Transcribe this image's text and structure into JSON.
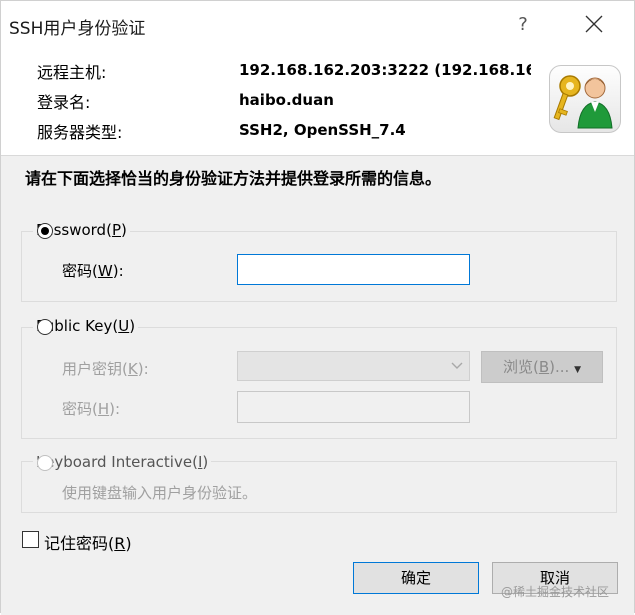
{
  "window": {
    "title": "SSH用户身份验证",
    "help": "?"
  },
  "info": {
    "remote_host_label": "远程主机:",
    "remote_host_value": "192.168.162.203:3222 (192.168.16",
    "login_label": "登录名:",
    "login_value": "haibo.duan",
    "server_type_label": "服务器类型:",
    "server_type_value": "SSH2, OpenSSH_7.4"
  },
  "instruction": "请在下面选择恰当的身份验证方法并提供登录所需的信息。",
  "password_group": {
    "title": "Password",
    "shortcut": "P",
    "selected": true,
    "password_label": "密码",
    "password_shortcut": "W",
    "password_value": ""
  },
  "publickey_group": {
    "title": "Public Key",
    "shortcut": "U",
    "selected": false,
    "user_key_label": "用户密钥",
    "user_key_shortcut": "K",
    "browse_label": "浏览",
    "browse_shortcut": "B",
    "browse_suffix": "...",
    "passphrase_label": "密码",
    "passphrase_shortcut": "H"
  },
  "keyboard_group": {
    "title": "Keyboard Interactive",
    "shortcut": "I",
    "description": "使用键盘输入用户身份验证。"
  },
  "remember": {
    "label": "记住密码",
    "shortcut": "R",
    "checked": false
  },
  "buttons": {
    "ok": "确定",
    "cancel": "取消"
  },
  "watermark": "@稀土掘金技术社区"
}
